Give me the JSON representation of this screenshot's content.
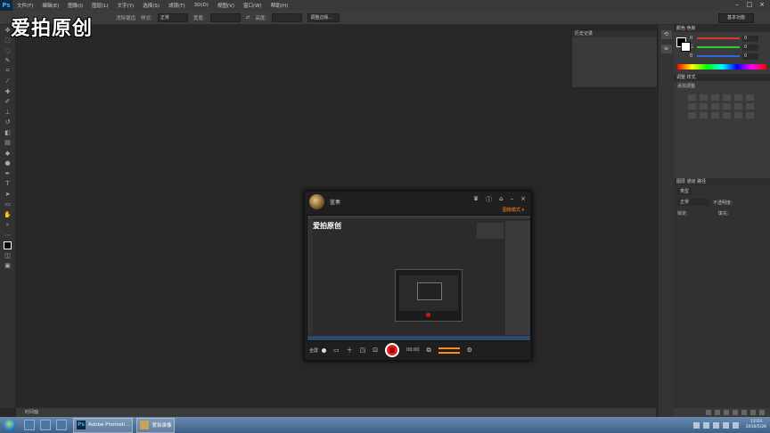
{
  "app": {
    "logo": "Ps"
  },
  "menubar": {
    "items": [
      "文件(F)",
      "编辑(E)",
      "图像(I)",
      "图层(L)",
      "文字(Y)",
      "选择(S)",
      "滤镜(T)",
      "3D(D)",
      "视图(V)",
      "窗口(W)",
      "帮助(H)"
    ]
  },
  "window_controls": {
    "minimize": "–",
    "maximize": "□",
    "close": "×"
  },
  "optbar": {
    "feather_label": "消除锯齿",
    "style_label": "样式:",
    "style_value": "正常",
    "width_label": "宽度:",
    "height_label": "高度:",
    "refine_label": "调整边缘...",
    "workspace": "基本功能"
  },
  "watermark": "爱拍原创",
  "history_panel": {
    "title": "历史记录"
  },
  "color_panel": {
    "tabs": "颜色  色板",
    "channels": [
      {
        "label": "R",
        "value": "0",
        "color": "#d33"
      },
      {
        "label": "G",
        "value": "0",
        "color": "#3c3"
      },
      {
        "label": "B",
        "value": "0",
        "color": "#36d"
      }
    ]
  },
  "adjust_panel": {
    "tabs": "调整  样式",
    "add_label": "添加调整"
  },
  "layers_panel": {
    "tabs": "图层  通道  路径",
    "kind": "类型",
    "blend": "正常",
    "opacity": "不透明度:",
    "lock": "锁定:",
    "fill": "填充:"
  },
  "canvas_status": "时间轴",
  "recorder": {
    "user": "蓝奏",
    "mode": "图像模式 ▾",
    "preview_watermark": "爱拍原创",
    "fullscreen_label": "全屏",
    "time": "00:00",
    "icons": {
      "crown": "♛",
      "info": "ⓘ",
      "home": "⌂",
      "minimize": "–",
      "close": "×"
    }
  },
  "taskbar": {
    "tasks": [
      "Adobe Photosh...",
      "爱拍录像"
    ],
    "clock_time": "13:03",
    "clock_date": "2016/5/26"
  }
}
